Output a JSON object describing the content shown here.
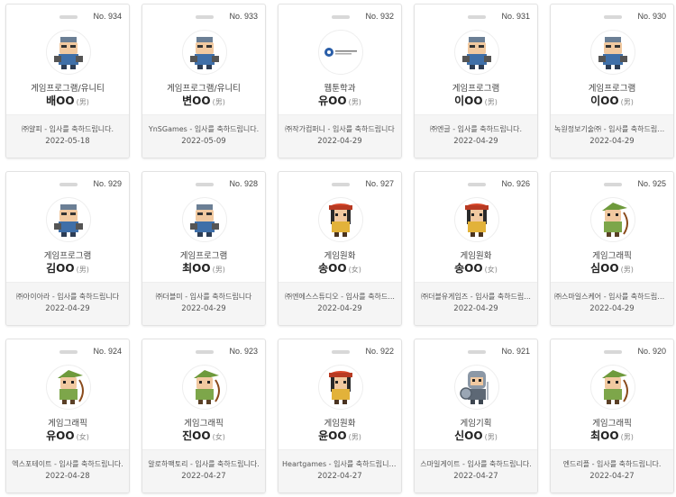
{
  "cards": [
    {
      "no": "No. 934",
      "avatar": "programmer-character-icon",
      "dept": "게임프로그램/유니티",
      "name": "배OO",
      "gender": "(男)",
      "message": "㈜얄피 - 입사를 축하드립니다.",
      "date": "2022-05-18"
    },
    {
      "no": "No. 933",
      "avatar": "programmer-character-icon",
      "dept": "게임프로그램/유니티",
      "name": "변OO",
      "gender": "(男)",
      "message": "YnSGames - 입사를 축하드립니다.",
      "date": "2022-05-09"
    },
    {
      "no": "No. 932",
      "avatar": "company-logo-icon",
      "dept": "웹툰학과",
      "name": "유OO",
      "gender": "(男)",
      "message": "㈜작가컴퍼니 - 입사를 축하드립니다",
      "date": "2022-04-29"
    },
    {
      "no": "No. 931",
      "avatar": "programmer-character-icon",
      "dept": "게임프로그램",
      "name": "이OO",
      "gender": "(男)",
      "message": "㈜엔글 - 입사를 축하드립니다.",
      "date": "2022-04-29"
    },
    {
      "no": "No. 930",
      "avatar": "programmer-character-icon",
      "dept": "게임프로그램",
      "name": "이OO",
      "gender": "(男)",
      "message": "녹원정보기술㈜ - 입사를 축하드립니다.",
      "date": "2022-04-29"
    },
    {
      "no": "No. 929",
      "avatar": "programmer-character-icon",
      "dept": "게임프로그램",
      "name": "김OO",
      "gender": "(男)",
      "message": "㈜아이아라 - 입사를 축하드립니다",
      "date": "2022-04-29"
    },
    {
      "no": "No. 928",
      "avatar": "programmer-character-icon",
      "dept": "게임프로그램",
      "name": "최OO",
      "gender": "(男)",
      "message": "㈜더블미 - 입사를 축하드립니다",
      "date": "2022-04-29"
    },
    {
      "no": "No. 927",
      "avatar": "planner-character-icon",
      "dept": "게임원화",
      "name": "송OO",
      "gender": "(女)",
      "message": "㈜엔에스스튜디오 - 입사를 축하드...",
      "date": "2022-04-29"
    },
    {
      "no": "No. 926",
      "avatar": "planner-character-icon",
      "dept": "게임원화",
      "name": "송OO",
      "gender": "(女)",
      "message": "㈜더블유게임즈 - 입사를 축하드립...",
      "date": "2022-04-29"
    },
    {
      "no": "No. 925",
      "avatar": "archer-character-icon",
      "dept": "게임그래픽",
      "name": "심OO",
      "gender": "(男)",
      "message": "㈜스마일스케어 - 입사를 축하드립니다",
      "date": "2022-04-29"
    },
    {
      "no": "No. 924",
      "avatar": "archer-character-icon",
      "dept": "게임그래픽",
      "name": "유OO",
      "gender": "(女)",
      "message": "엑스포테이트 - 입사를 축하드립니다.",
      "date": "2022-04-28"
    },
    {
      "no": "No. 923",
      "avatar": "archer-character-icon",
      "dept": "게임그래픽",
      "name": "진OO",
      "gender": "(女)",
      "message": "알로하팩토리 - 입사를 축하드립니다.",
      "date": "2022-04-27"
    },
    {
      "no": "No. 922",
      "avatar": "planner-character-icon",
      "dept": "게임원화",
      "name": "윤OO",
      "gender": "(男)",
      "message": "Heartgames - 입사를 축하드립니다.",
      "date": "2022-04-27"
    },
    {
      "no": "No. 921",
      "avatar": "knight-character-icon",
      "dept": "게임기획",
      "name": "신OO",
      "gender": "(男)",
      "message": "스마일게이트 - 입사를 축하드립니다.",
      "date": "2022-04-27"
    },
    {
      "no": "No. 920",
      "avatar": "archer-character-icon",
      "dept": "게임그래픽",
      "name": "최OO",
      "gender": "(男)",
      "message": "엔드리플 - 입사를 축하드립니다.",
      "date": "2022-04-27"
    }
  ]
}
